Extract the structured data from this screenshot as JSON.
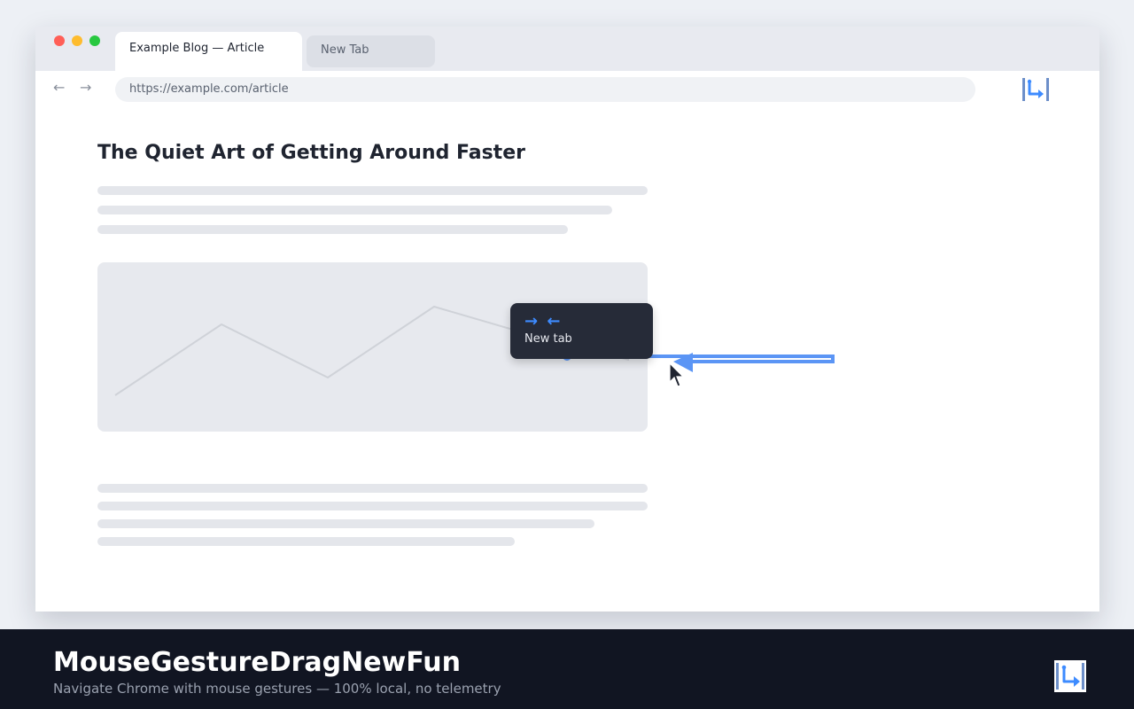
{
  "browser": {
    "tabs": [
      {
        "label": "Example Blog — Article",
        "active": true
      },
      {
        "label": "New Tab",
        "active": false
      }
    ],
    "url": "https://example.com/article",
    "back_icon": "←",
    "forward_icon": "→"
  },
  "article": {
    "title": "The Quiet Art of Getting Around Faster"
  },
  "gesture": {
    "arrows": "→ ←",
    "action_label": "New tab",
    "trail_color": "#5b95f5",
    "accent_color": "#3d8bff"
  },
  "footer": {
    "app_name": "MouseGestureDragNewFun",
    "tagline": "Navigate Chrome with mouse gestures  —  100% local, no telemetry"
  },
  "icons": {
    "extension": "gesture-corner-arrow-icon",
    "cursor": "mouse-pointer-icon"
  }
}
